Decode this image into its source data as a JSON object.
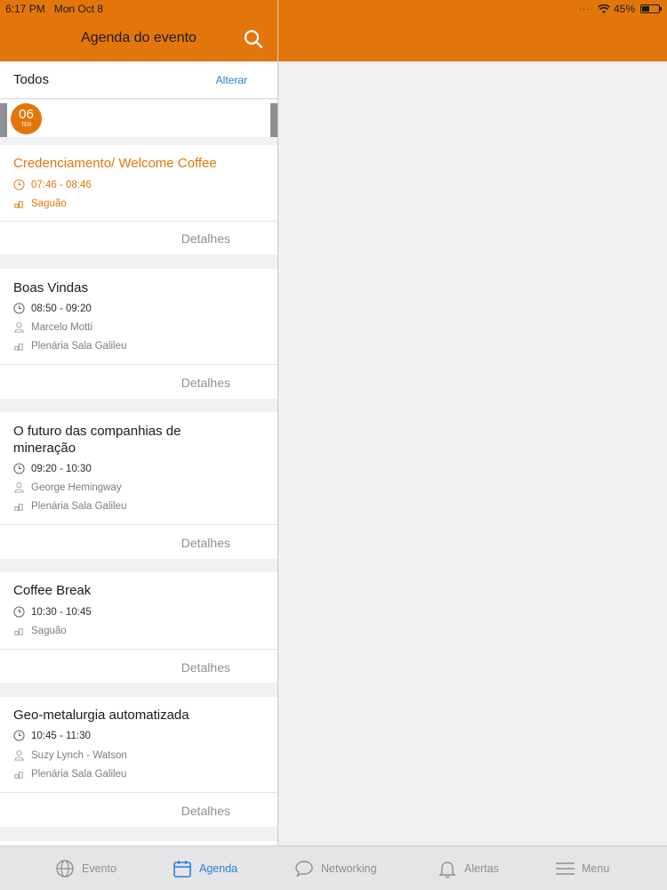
{
  "status": {
    "time": "6:17 PM",
    "date": "Mon Oct 8",
    "battery": "45%",
    "battery_level": 0.45
  },
  "header": {
    "title": "Agenda do evento"
  },
  "filter": {
    "label": "Todos",
    "change": "Alterar"
  },
  "date": {
    "day": "06",
    "weekday": "TER"
  },
  "sessions": [
    {
      "title": "Credenciamento/ Welcome Coffee",
      "time": "07:46 - 08:46",
      "place": "Saguão",
      "details": "Detalhes"
    },
    {
      "title": "Boas Vindas",
      "time": "08:50 - 09:20",
      "speaker": "Marcelo Motti",
      "place": "Plenária Sala Galileu",
      "details": "Detalhes"
    },
    {
      "title": "O futuro das companhias de mineração",
      "time": "09:20 - 10:30",
      "speaker": "George Hemingway",
      "place": "Plenária Sala Galileu",
      "details": "Detalhes"
    },
    {
      "title": "Coffee Break",
      "time": "10:30 - 10:45",
      "place": "Saguão",
      "details": "Detalhes"
    },
    {
      "title": "Geo-metalurgia automatizada",
      "time": "10:45 - 11:30",
      "speaker": "Suzy Lynch - Watson",
      "place": "Plenária Sala Galileu",
      "details": "Detalhes"
    }
  ],
  "tabs": {
    "evento": "Evento",
    "agenda": "Agenda",
    "networking": "Networking",
    "alertas": "Alertas",
    "menu": "Menu"
  },
  "colors": {
    "accent": "#e3760b",
    "link": "#2a7fd4"
  }
}
